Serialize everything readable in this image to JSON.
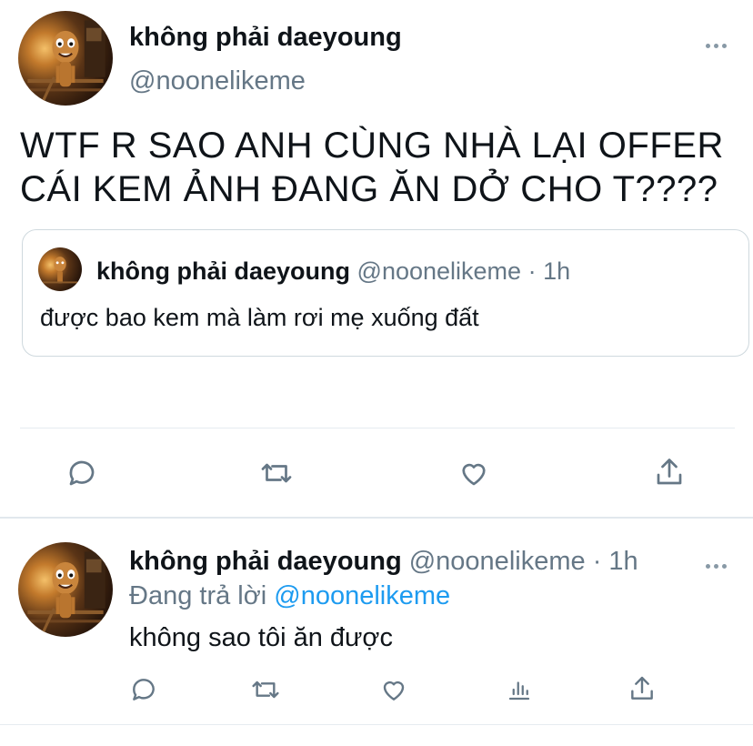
{
  "tweet": {
    "author_name": "không phải daeyoung",
    "author_handle": "@noonelikeme",
    "text_line1": "WTF R SAO ANH CÙNG NHÀ LẠI OFFER",
    "text_line2": "CÁI KEM ẢNH ĐANG ĂN DỞ CHO T????",
    "quoted": {
      "author_name": "không phải daeyoung",
      "author_handle": "@noonelikeme",
      "dot": "·",
      "time": "1h",
      "text": "được bao kem mà làm rơi mẹ xuống đất"
    },
    "actions": [
      "reply-icon",
      "retweet-icon",
      "like-icon",
      "share-icon"
    ]
  },
  "reply": {
    "author_name": "không phải daeyoung",
    "author_handle": "@noonelikeme",
    "dot": "·",
    "time": "1h",
    "replying_prefix": "Đang trả lời",
    "replying_to": "@noonelikeme",
    "text": "không sao tôi ăn được",
    "actions": [
      "reply-icon",
      "retweet-icon",
      "like-icon",
      "analytics-icon",
      "share-icon"
    ]
  },
  "colors": {
    "text": "#0f1419",
    "muted": "#657786",
    "link": "#1d9bf0",
    "border": "#cfd9de",
    "divider": "#e6ecf0"
  }
}
